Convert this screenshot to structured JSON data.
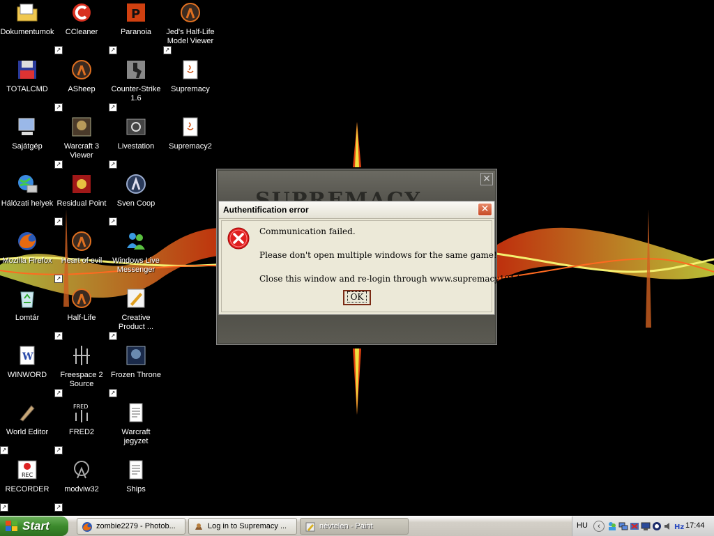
{
  "desktop": {
    "icons": [
      {
        "label": "Dokumentumok",
        "icon": "folder-icon"
      },
      {
        "label": "CCleaner",
        "icon": "ccleaner-icon"
      },
      {
        "label": "Paranoia",
        "icon": "paranoia-icon"
      },
      {
        "label": "Jed's Half-Life Model Viewer",
        "icon": "halflife-icon"
      },
      {
        "label": "TOTALCMD",
        "icon": "floppy-icon"
      },
      {
        "label": "ASheep",
        "icon": "halflife-icon"
      },
      {
        "label": "Counter-Strike 1.6",
        "icon": "counter-strike-icon"
      },
      {
        "label": "Supremacy",
        "icon": "java-file-icon"
      },
      {
        "label": "Sajátgép",
        "icon": "my-computer-icon"
      },
      {
        "label": "Warcraft 3 Viewer",
        "icon": "warcraft-icon"
      },
      {
        "label": "Livestation",
        "icon": "livestation-icon"
      },
      {
        "label": "Supremacy2",
        "icon": "java-file-icon"
      },
      {
        "label": "Hálózati helyek",
        "icon": "network-icon"
      },
      {
        "label": "Residual Point",
        "icon": "residual-point-icon"
      },
      {
        "label": "Sven Coop",
        "icon": "sven-coop-icon"
      },
      {
        "label": "Mozilla Firefox",
        "icon": "firefox-icon"
      },
      {
        "label": "Heart of evil",
        "icon": "halflife-icon"
      },
      {
        "label": "Windows Live Messenger",
        "icon": "messenger-icon"
      },
      {
        "label": "Lomtár",
        "icon": "recycle-bin-icon"
      },
      {
        "label": "Half-Life",
        "icon": "halflife-icon"
      },
      {
        "label": "Creative Product ...",
        "icon": "creative-icon"
      },
      {
        "label": "WINWORD",
        "icon": "word-icon"
      },
      {
        "label": "Freespace 2 Source",
        "icon": "freespace-icon"
      },
      {
        "label": "Frozen Throne",
        "icon": "frozen-throne-icon"
      },
      {
        "label": "World Editor",
        "icon": "world-editor-icon"
      },
      {
        "label": "FRED2",
        "icon": "fred2-icon"
      },
      {
        "label": "Warcraft jegyzet",
        "icon": "text-file-icon"
      },
      {
        "label": "RECORDER",
        "icon": "recorder-icon"
      },
      {
        "label": "modviw32",
        "icon": "modviw-icon"
      },
      {
        "label": "Ships",
        "icon": "text-file-icon"
      }
    ]
  },
  "game_window": {
    "banner_text": "SUPREMACY",
    "close_glyph": "✕"
  },
  "dialog": {
    "title": "Authentification error",
    "close_glyph": "✕",
    "line1": "Communication failed.",
    "line2": "Please don't open multiple windows for the same game!",
    "line3": "Close this window and re-login through www.supremacy1914.com.",
    "ok_label": "OK",
    "icon": "error-icon"
  },
  "taskbar": {
    "start_label": "Start",
    "tasks": [
      {
        "label": "zombie2279 - Photob...",
        "icon": "firefox-icon"
      },
      {
        "label": "Log in to Supremacy ...",
        "icon": "supremacy-icon"
      },
      {
        "label": "névtelen - Paint",
        "icon": "paint-icon"
      }
    ],
    "language": "HU",
    "expand_glyph": "‹",
    "clock": "17:44"
  }
}
